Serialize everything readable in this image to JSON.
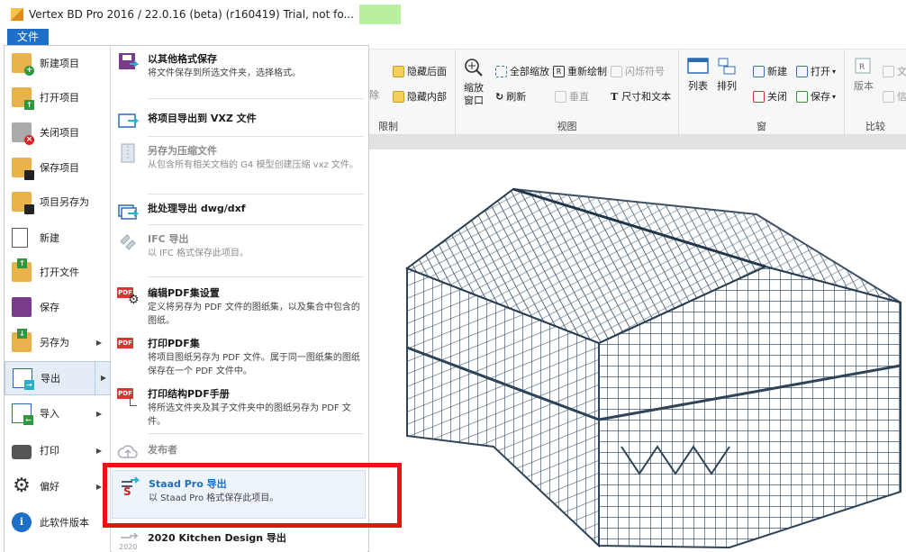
{
  "window": {
    "title": "Vertex BD Pro 2016 / 22.0.16 (beta) (r160419) Trial, not fo..."
  },
  "file_tab": {
    "label": "文件"
  },
  "left_menu": [
    {
      "label": "新建项目",
      "icon": "new-project-icon",
      "arrow": ""
    },
    {
      "label": "打开项目",
      "icon": "open-project-icon",
      "arrow": ""
    },
    {
      "label": "关闭项目",
      "icon": "close-project-icon",
      "arrow": ""
    },
    {
      "label": "保存项目",
      "icon": "save-project-icon",
      "arrow": ""
    },
    {
      "label": "项目另存为",
      "icon": "save-project-as-icon",
      "arrow": ""
    },
    {
      "label": "新建",
      "icon": "new-file-icon",
      "arrow": ""
    },
    {
      "label": "打开文件",
      "icon": "open-file-icon",
      "arrow": ""
    },
    {
      "label": "保存",
      "icon": "save-icon",
      "arrow": ""
    },
    {
      "label": "另存为",
      "icon": "save-as-icon",
      "arrow": "▶"
    },
    {
      "label": "导出",
      "icon": "export-icon",
      "arrow": "▶"
    },
    {
      "label": "导入",
      "icon": "import-icon",
      "arrow": "▶"
    },
    {
      "label": "打印",
      "icon": "printer-icon",
      "arrow": "▶"
    },
    {
      "label": "偏好",
      "icon": "gear-icon",
      "arrow": "▶"
    },
    {
      "label": "此软件版本",
      "icon": "info-icon",
      "arrow": ""
    }
  ],
  "export_menu": [
    {
      "title": "以其他格式保存",
      "desc": "将文件保存到所选文件夹，选择格式。"
    },
    {
      "title": "将项目导出到 VXZ 文件",
      "desc": ""
    },
    {
      "title": "另存为压缩文件",
      "desc": "从包含所有相关文档的 G4 模型创建压缩 vxz 文件。"
    },
    {
      "title": "批处理导出 dwg/dxf",
      "desc": ""
    },
    {
      "title": "IFC 导出",
      "desc": "以 IFC 格式保存此项目。"
    },
    {
      "title": "编辑PDF集设置",
      "desc": "定义将另存为 PDF 文件的图纸集，以及集合中包含的图纸。"
    },
    {
      "title": "打印PDF集",
      "desc": "将项目图纸另存为 PDF 文件。属于同一图纸集的图纸保存在一个 PDF 文件中。"
    },
    {
      "title": "打印结构PDF手册",
      "desc": "将所选文件夹及其子文件夹中的图纸另存为 PDF 文件。"
    },
    {
      "title": "发布者",
      "desc": ""
    },
    {
      "title": "Staad Pro 导出",
      "desc": "以 Staad Pro 格式保存此项目。"
    },
    {
      "title": "2020 Kitchen Design 导出",
      "desc": ""
    }
  ],
  "pdf_badge": "PDF",
  "ribbon": {
    "restrict": {
      "label": "限制",
      "hide_back": "隐藏后面",
      "hide_inner": "隐藏内部",
      "remove_partial": "除"
    },
    "view": {
      "label": "视图",
      "zoom_window": "缩放窗口",
      "zoom_all": "全部缩放",
      "redraw": "重新绘制",
      "flash_symbol": "闪烁符号",
      "refresh": "刷新",
      "vertical": "垂直",
      "dim_text": "尺寸和文本"
    },
    "window": {
      "label": "窗",
      "list": "列表",
      "arrange": "排列",
      "new": "新建",
      "open": "打开",
      "close": "关闭",
      "save": "保存"
    },
    "compare": {
      "label": "比较",
      "version": "版本",
      "partial1": "文",
      "partial2": "信"
    }
  },
  "colors": {
    "accent": "#1e6fc7",
    "highlight": "#ee1111",
    "frame": "#3d566e"
  }
}
